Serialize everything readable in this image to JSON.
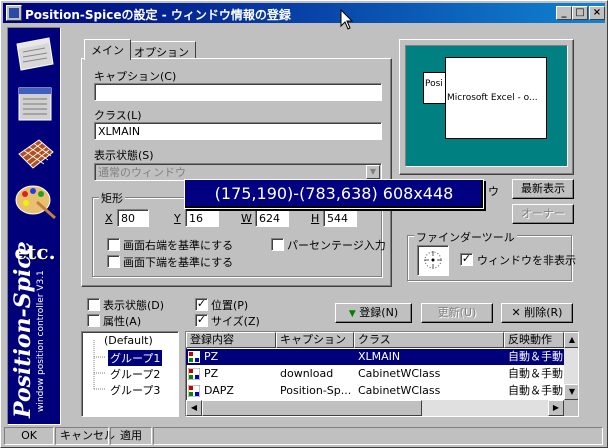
{
  "window": {
    "title": "Position-Spiceの設定 - ウィンドウ情報の登録",
    "minimize": "_",
    "maximize": "□",
    "close": "×"
  },
  "sidebar": {
    "brand": "Position-Spice",
    "subtitle": "window position controller V3.1",
    "icons": [
      "window-align-icon",
      "window-list-icon",
      "grid-icon",
      "palette-icon",
      "etc-icon"
    ],
    "etc_label": "etc."
  },
  "tabs": [
    {
      "label": "メイン"
    },
    {
      "label": "オプション"
    }
  ],
  "form": {
    "caption_label": "キャプション(C)",
    "caption_value": "",
    "class_label": "クラス(L)",
    "class_value": "XLMAIN",
    "display_label": "表示状態(S)",
    "display_value": "通常のウィンドウ",
    "rect_group": "矩形",
    "x_label": "X",
    "x_value": "80",
    "y_label": "Y",
    "y_value": "16",
    "w_label": "W",
    "w_value": "624",
    "h_label": "H",
    "h_value": "544",
    "chk_right_edge": "画面右端を基準にする",
    "chk_bottom_edge": "画面下端を基準にする",
    "chk_percent": "パーセンテージ入力"
  },
  "tooltip": {
    "text": "(175,190)-(783,638) 608x448"
  },
  "preview": {
    "small_window": "Posi",
    "big_window": "Microsoft Excel - o...",
    "hidden_label": "ウ",
    "update_button": "最新表示",
    "owner_button": "オーナー"
  },
  "finder": {
    "group_title": "ファインダーツール",
    "hide_window_label": "ウィンドウを非表示"
  },
  "options": {
    "display_state": "表示状態(D)",
    "attribute": "属性(A)",
    "position": "位置(P)",
    "size": "サイズ(Z)"
  },
  "actions": {
    "register": "登録(N)",
    "update": "更新(U)",
    "delete": "削除(R)"
  },
  "tree": {
    "items": [
      "(Default)",
      "グループ1",
      "グループ2",
      "グループ3"
    ],
    "selected_index": 1
  },
  "table": {
    "headers": [
      "登録内容",
      "キャプション",
      "クラス",
      "反映動作"
    ],
    "rows": [
      {
        "name": "PZ",
        "caption": "",
        "class": "XLMAIN",
        "action": "自動＆手動",
        "selected": true
      },
      {
        "name": "PZ",
        "caption": "download",
        "class": "CabinetWClass",
        "action": "自動＆手動",
        "selected": false
      },
      {
        "name": "DAPZ",
        "caption": "Position-Sp...",
        "class": "CabinetWClass",
        "action": "自動＆手動",
        "selected": false
      }
    ]
  },
  "status": {
    "ok": "OK",
    "cancel": "キャンセル",
    "apply": "適用"
  },
  "colors": {
    "titlebar": "#00007b",
    "preview_bg": "#008080",
    "selection": "#00007b",
    "tooltip_bg": "#000080"
  }
}
